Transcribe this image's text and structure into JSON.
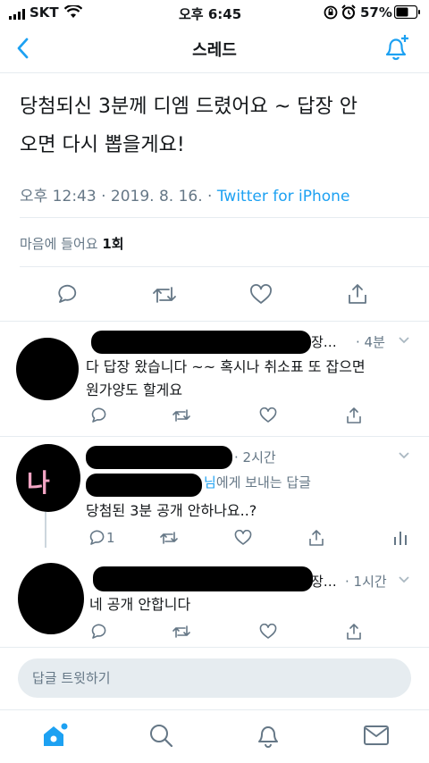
{
  "status_bar": {
    "carrier": "SKT",
    "time": "오후 6:45",
    "battery": "57%"
  },
  "header": {
    "title": "스레드"
  },
  "main_tweet": {
    "text_line1": "당첨되신 3분께 디엠 드렸어요 ~ 답장 안",
    "text_line2": "오면 다시 뽑을게요!",
    "time": "오후 12:43",
    "dot1": "·",
    "date": "2019. 8. 16.",
    "dot2": "·",
    "source": "Twitter for iPhone",
    "likes_label": "마음에 들어요",
    "likes_count": "1회"
  },
  "replies": [
    {
      "name_suffix": "장…",
      "time": "· 4분",
      "text_line1": "다 답장 왔습니다 ~~ 혹시나 취소표 또 잡으면",
      "text_line2": "원가양도 할게요"
    },
    {
      "time": "· 2시간",
      "reply_to_suffix": "님",
      "reply_to_label": "에게 보내는 답글",
      "avatar_glyph": "나",
      "text": "당첨된 3분 공개 안하나요..?",
      "reply_count": "1"
    },
    {
      "name_suffix": "장…",
      "time": "· 1시간",
      "text": "네 공개 안합니다"
    }
  ],
  "compose": {
    "placeholder": "답글 트윗하기"
  },
  "colors": {
    "accent": "#1da1f2",
    "gray": "#657786",
    "border": "#e6ecf0"
  }
}
